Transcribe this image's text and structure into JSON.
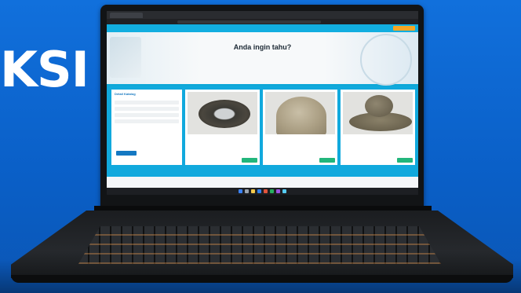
{
  "backdrop": {
    "partial_text": "KSI",
    "background_color": "#0d6ad6"
  },
  "screen": {
    "site_brand": "",
    "hero": {
      "title": "Anda ingin tahu?"
    },
    "filter": {
      "title": "Detail Katalog"
    },
    "cards": [
      {
        "icon": "stone-mortar-icon"
      },
      {
        "icon": "stone-tool-icon"
      },
      {
        "icon": "stone-grinder-icon"
      }
    ]
  }
}
